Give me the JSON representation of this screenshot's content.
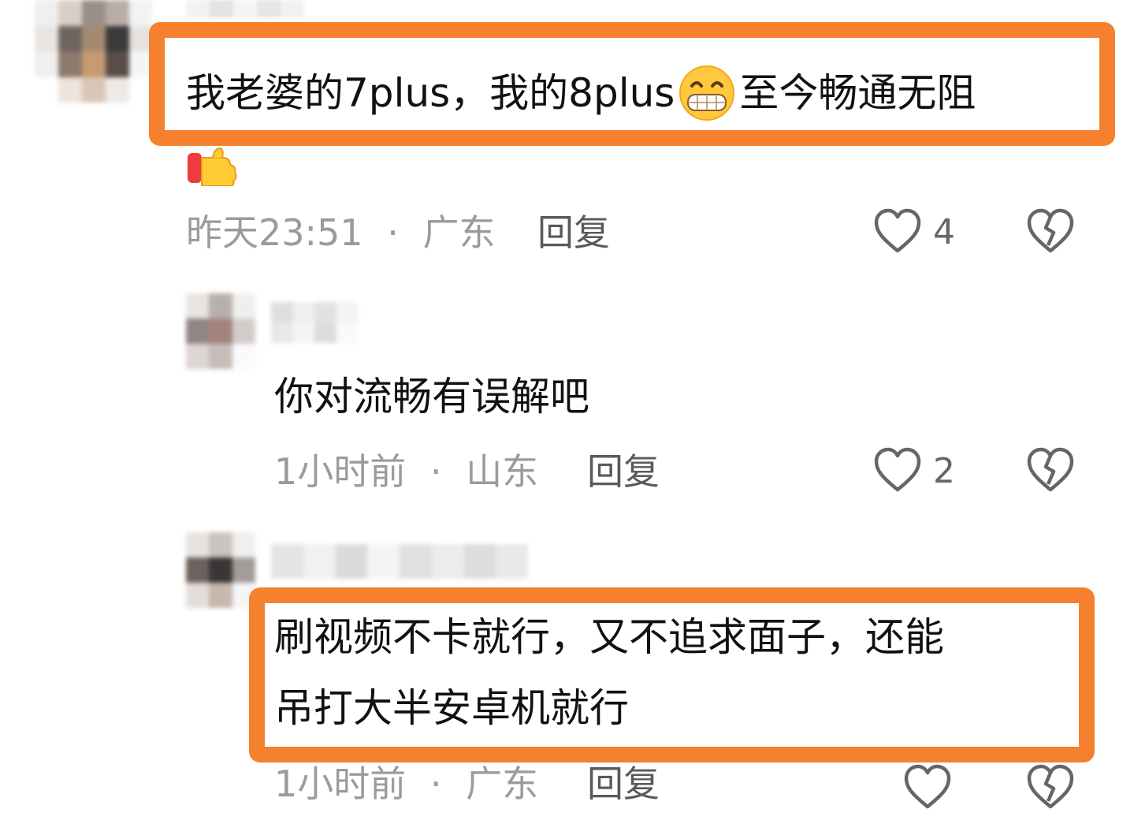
{
  "comments": [
    {
      "text": "我老婆的7plus，我的8plus",
      "text_after_emoji": "至今畅通无阻",
      "emoji_inline": "grinning-face",
      "emoji_trailing": "thumbs-up",
      "time": "昨天23:51",
      "separator": "·",
      "location": "广东",
      "reply_label": "回复",
      "likes": "4"
    },
    {
      "text": "你对流畅有误解吧",
      "time": "1小时前",
      "separator": "·",
      "location": "山东",
      "reply_label": "回复",
      "likes": "2"
    },
    {
      "text_line1": "刷视频不卡就行，又不追求面子，还能",
      "text_line2": "吊打大半安卓机就行",
      "time": "1小时前",
      "separator": "·",
      "location": "广东",
      "reply_label": "回复"
    }
  ],
  "colors": {
    "highlight": "#f5812f",
    "meta": "#9b9b9b",
    "text": "#111111"
  }
}
